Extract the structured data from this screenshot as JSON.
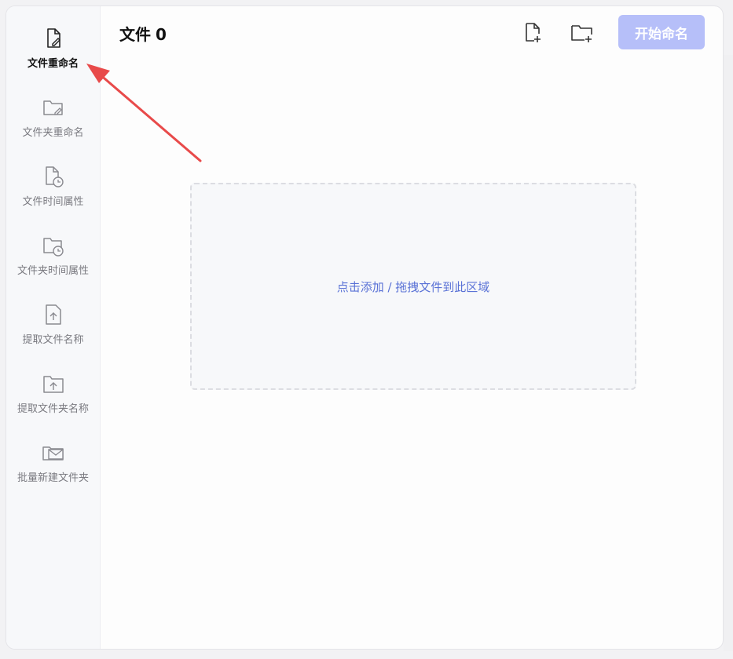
{
  "header": {
    "title": "文件",
    "file_count": "0",
    "add_file_icon": "file-plus-icon",
    "add_folder_icon": "folder-plus-icon",
    "start_button_label": "开始命名"
  },
  "sidebar": {
    "items": [
      {
        "label": "文件重命名",
        "icon": "file-edit-icon",
        "active": true
      },
      {
        "label": "文件夹重命名",
        "icon": "folder-edit-icon",
        "active": false
      },
      {
        "label": "文件时间属性",
        "icon": "file-clock-icon",
        "active": false
      },
      {
        "label": "文件夹时间属性",
        "icon": "folder-clock-icon",
        "active": false
      },
      {
        "label": "提取文件名称",
        "icon": "file-upload-icon",
        "active": false
      },
      {
        "label": "提取文件夹名称",
        "icon": "folder-upload-icon",
        "active": false
      },
      {
        "label": "批量新建文件夹",
        "icon": "folder-mail-icon",
        "active": false
      }
    ]
  },
  "dropzone": {
    "hint": "点击添加 / 拖拽文件到此区域"
  },
  "colors": {
    "accent": "#5a72d6",
    "start_button_bg": "#b6bff9",
    "arrow": "#e84a4a"
  }
}
